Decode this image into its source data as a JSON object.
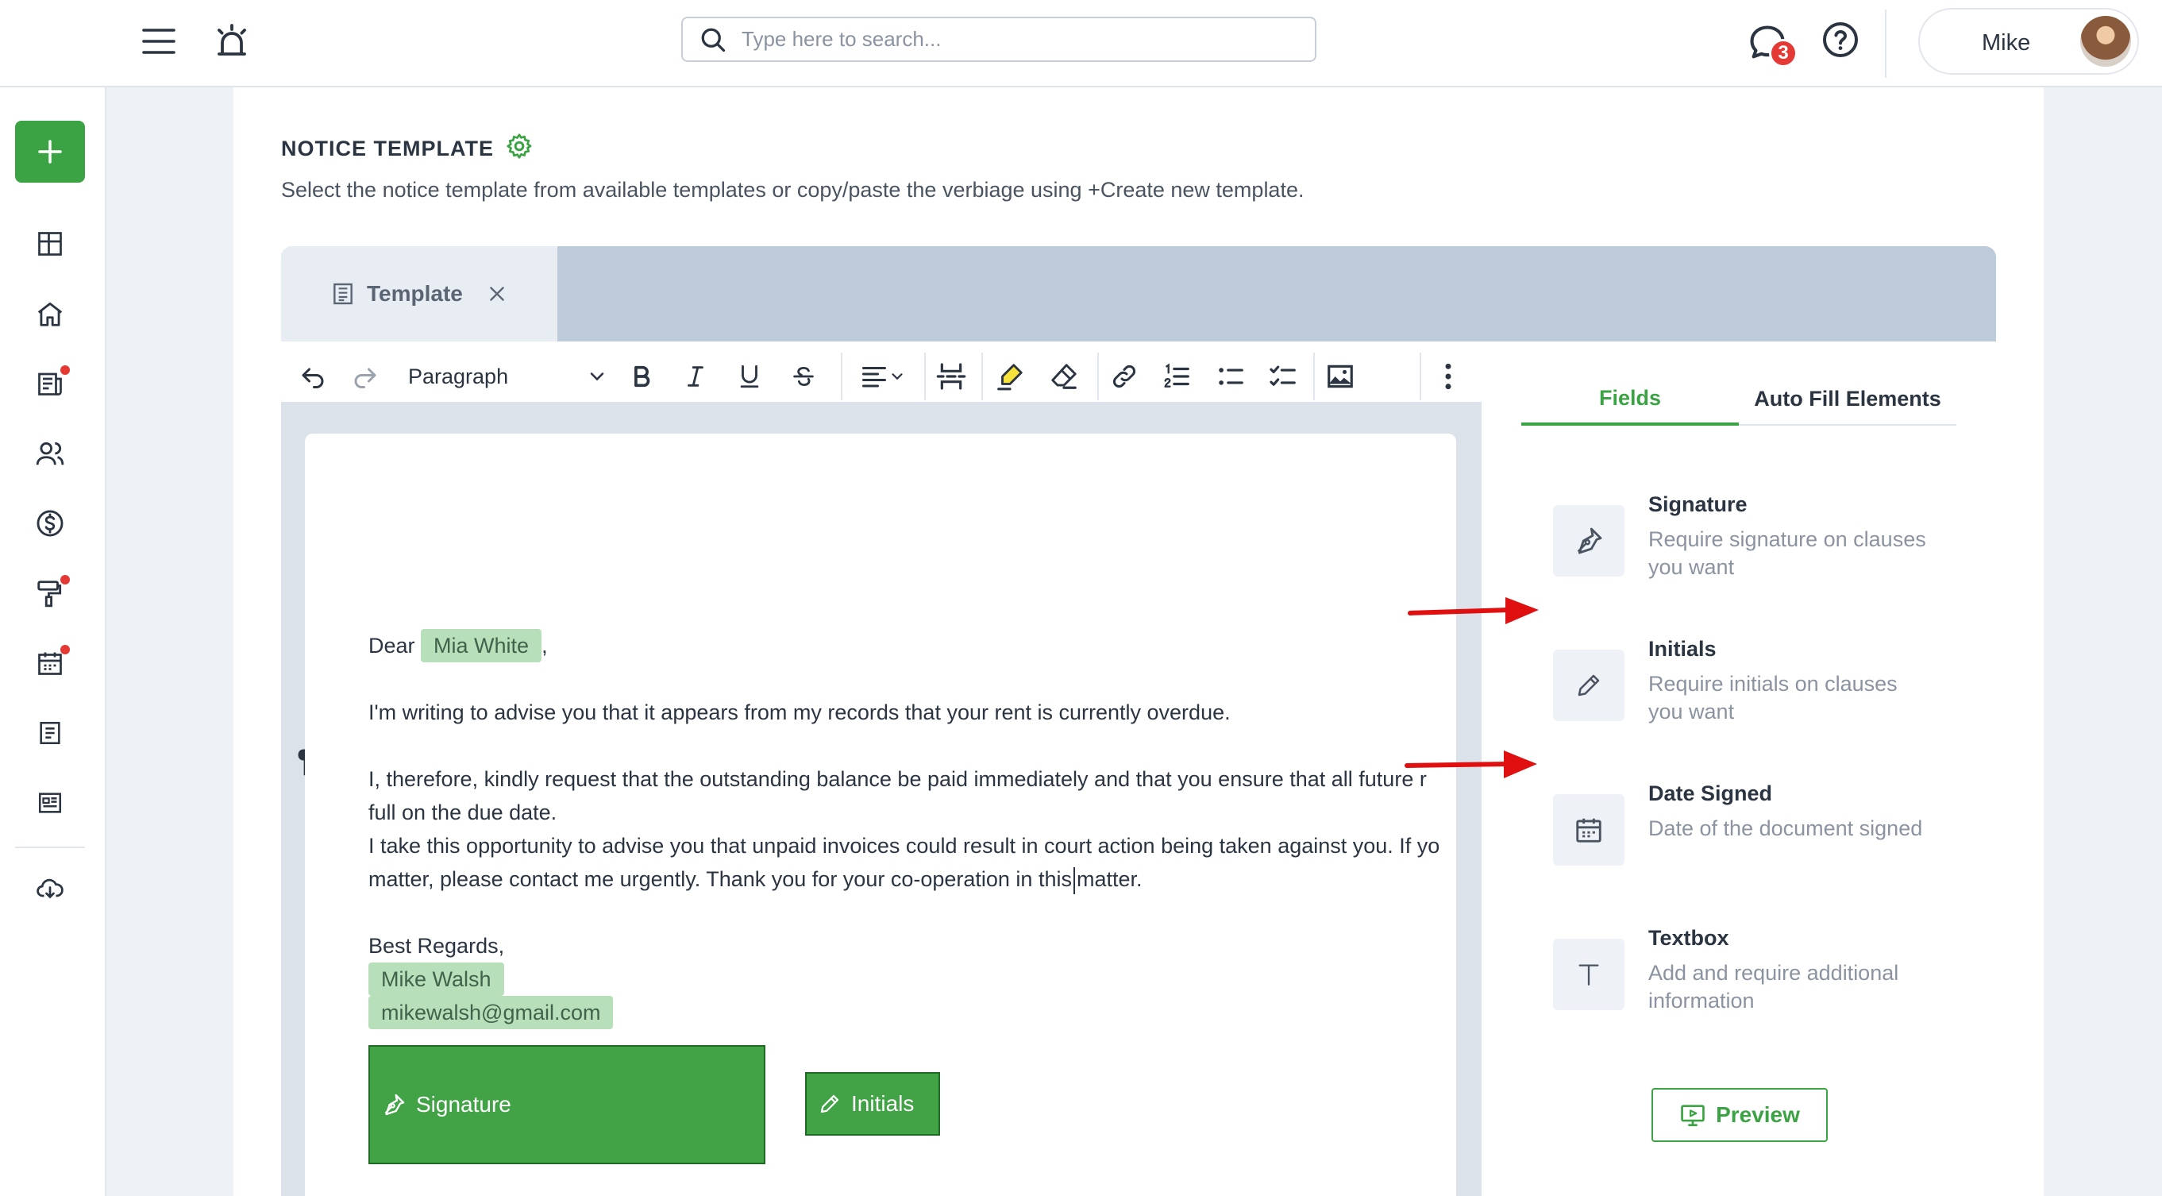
{
  "header": {
    "search_placeholder": "Type here to search...",
    "notification_count": "3",
    "user_name": "Mike"
  },
  "sidebar": {
    "items": [
      {
        "icon": "dashboard-icon",
        "has_dot": false
      },
      {
        "icon": "home-icon",
        "has_dot": false
      },
      {
        "icon": "newspaper-icon",
        "has_dot": true
      },
      {
        "icon": "users-icon",
        "has_dot": false
      },
      {
        "icon": "dollar-icon",
        "has_dot": false
      },
      {
        "icon": "paint-roller-icon",
        "has_dot": true
      },
      {
        "icon": "calendar-icon",
        "has_dot": true
      },
      {
        "icon": "document-icon",
        "has_dot": false
      },
      {
        "icon": "id-card-icon",
        "has_dot": false
      },
      {
        "icon": "cloud-download-icon",
        "has_dot": false
      }
    ],
    "dot_color": "#e53935"
  },
  "page": {
    "title": "NOTICE TEMPLATE",
    "description": "Select the notice template from available templates or copy/paste the verbiage using +Create new template."
  },
  "tab": {
    "label": "Template"
  },
  "toolbar": {
    "paragraph_style": "Paragraph"
  },
  "document": {
    "greeting": "Dear",
    "recipient": "Mia White",
    "greeting_suffix": ",",
    "p1": "I'm writing to advise you that it appears from my records that your rent is currently overdue.",
    "p2_line1": "I, therefore, kindly request that the outstanding balance be paid immediately and that you ensure that all future r",
    "p2_line2": "full on the due date.",
    "p3_line1": "I take this opportunity to advise you that unpaid invoices could result in court action being taken against you. If yo",
    "p3_line2_a": "matter, please contact me urgently. Thank you for your co-operation in this",
    "p3_line2_b": "matter.",
    "closing": "Best Regards,",
    "sender_name": "Mike Walsh",
    "sender_email": "mikewalsh@gmail.com"
  },
  "placed_fields": {
    "signature_label": "Signature",
    "initials_label": "Initials"
  },
  "right_panel": {
    "tabs": [
      "Fields",
      "Auto Fill Elements"
    ],
    "active_tab": "Fields",
    "fields": [
      {
        "title": "Signature",
        "description": "Require signature on clauses you want",
        "icon": "pen-nib-icon"
      },
      {
        "title": "Initials",
        "description": "Require initials on clauses you want",
        "icon": "pencil-icon"
      },
      {
        "title": "Date Signed",
        "description": "Date of the document signed",
        "icon": "calendar-icon"
      },
      {
        "title": "Textbox",
        "description": "Add and require additional information",
        "icon": "text-t-icon"
      }
    ],
    "preview_label": "Preview"
  },
  "colors": {
    "brand_green": "#3ba344",
    "chip_green": "#b7e0ba",
    "arrow_red": "#e01010"
  }
}
